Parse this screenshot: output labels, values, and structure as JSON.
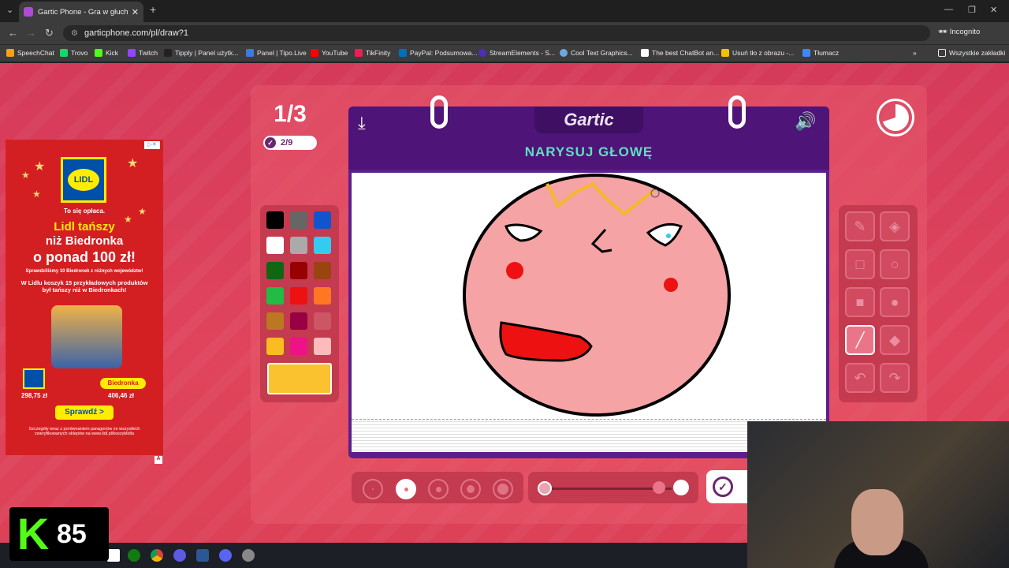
{
  "browser": {
    "tab_title": "Gartic Phone - Gra w głuchy tel",
    "url": "garticphone.com/pl/draw?1",
    "incognito_label": "Incognito",
    "bookmarks": [
      "SpeechChat",
      "Trovo",
      "Kick",
      "Twitch",
      "Tipply | Panel użytk...",
      "Panel | Tipo.Live",
      "YouTube",
      "TikFinity",
      "PayPal: Podsumowa...",
      "StreamElements - S...",
      "Cool Text Graphics...",
      "The best ChatBot an...",
      "Usuń tło z obrazu -...",
      "Tłumacz"
    ],
    "all_bookmarks_label": "Wszystkie zakładki"
  },
  "game": {
    "round": "1/3",
    "progress": "2/9",
    "logo": "Gartic",
    "prompt": "NARYSUJ GŁOWĘ",
    "timer_remaining_fraction": 0.7,
    "palette": [
      "#000000",
      "#666666",
      "#1155cc",
      "#ffffff",
      "#aaaaaa",
      "#33ccf0",
      "#116611",
      "#990000",
      "#994411",
      "#22bb44",
      "#ee1111",
      "#ff7722",
      "#bb7722",
      "#990044",
      "#cc5566",
      "#f9bd22",
      "#ee1188",
      "#ffbbbb"
    ],
    "selected_color": "#f9c22e",
    "tools": [
      "pencil-icon",
      "eraser-icon",
      "rectangle-outline-icon",
      "ellipse-outline-icon",
      "rectangle-fill-icon",
      "ellipse-fill-icon",
      "line-icon",
      "fill-bucket-icon",
      "undo-icon",
      "redo-icon"
    ],
    "active_tool": "line-icon",
    "stroke_sizes": 5,
    "active_stroke_size": 2,
    "opacity_fraction": 1.0
  },
  "ad": {
    "tagline": "To się opłaca.",
    "headline1": "Lidl tańszy",
    "headline2": "niż Biedronka",
    "headline3": "o ponad 100 zł!",
    "note": "Sprawdziliśmy 10 Biedronek z różnych województw!",
    "body": "W Lidlu koszyk 15 przykładowych produktów był tańszy niż w Biedronkach!",
    "brand": "LIDL",
    "price_lidl": "298,75 zł",
    "competitor": "Biedronka",
    "price_competitor": "406,46 zł",
    "cta": "Sprawdź >",
    "footer": "Szczegóły wraz z porównaniem paragonów ze wszystkich zweryfikowanych sklepów na www.lidl.pl/koszyklidla"
  },
  "overlay": {
    "kick_count": "85"
  }
}
